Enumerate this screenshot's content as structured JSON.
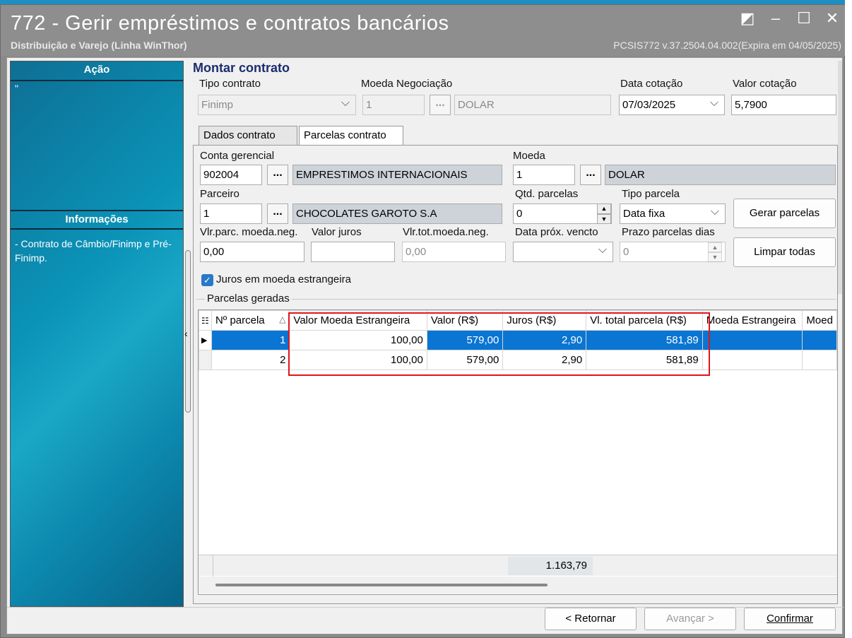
{
  "window": {
    "title": "772 - Gerir empréstimos e contratos bancários",
    "subtitle": "Distribuição e Varejo (Linha WinThor)",
    "version": "PCSIS772  v.37.2504.04.002(Expira em 04/05/2025)",
    "buttons": [
      "◩",
      "–",
      "☐",
      "✕"
    ]
  },
  "sidebar": {
    "acao_title": "Ação",
    "acao_text": "\"",
    "info_title": "Informações",
    "info_text": " - Contrato de Câmbio/Finimp e Pré-Finimp."
  },
  "form": {
    "heading": "Montar contrato",
    "tipo_contrato_label": "Tipo contrato",
    "tipo_contrato_value": "Finimp",
    "moeda_neg_label": "Moeda Negociação",
    "moeda_neg_code": "1",
    "moeda_neg_name": "DOLAR",
    "data_cotacao_label": "Data cotação",
    "data_cotacao_value": "07/03/2025",
    "valor_cotacao_label": "Valor cotação",
    "valor_cotacao_value": "5,7900",
    "ellipsis": "..."
  },
  "tabs": [
    {
      "label": "Dados contrato"
    },
    {
      "label": "Parcelas contrato"
    }
  ],
  "parcelas": {
    "conta_label": "Conta gerencial",
    "conta_code": "902004",
    "conta_name": "EMPRESTIMOS INTERNACIONAIS",
    "moeda_label": "Moeda",
    "moeda_code": "1",
    "moeda_name": "DOLAR",
    "parceiro_label": "Parceiro",
    "parceiro_code": "1",
    "parceiro_name": "CHOCOLATES GAROTO S.A",
    "qtd_label": "Qtd. parcelas",
    "qtd_value": "0",
    "tipo_parcela_label": "Tipo parcela",
    "tipo_parcela_value": "Data fixa",
    "gerar_button": "Gerar parcelas",
    "limpar_button": "Limpar todas",
    "vlr_parc_label": "Vlr.parc. moeda.neg.",
    "vlr_parc_value": "0,00",
    "valor_juros_label": "Valor juros",
    "valor_juros_value": "",
    "vlr_tot_label": "Vlr.tot.moeda.neg.",
    "vlr_tot_value": "0,00",
    "data_prox_label": "Data próx. vencto",
    "data_prox_value": "",
    "prazo_label": "Prazo parcelas dias",
    "prazo_value": "0",
    "juros_check_label": "Juros em moeda estrangeira",
    "juros_checked": true,
    "group_label": "Parcelas geradas"
  },
  "grid": {
    "columns": [
      "Nº parcela",
      "Valor Moeda Estrangeira",
      "Valor (R$)",
      "Juros (R$)",
      "Vl. total parcela (R$)",
      "Moeda Estrangeira",
      "Moed"
    ],
    "rows": [
      {
        "n": "1",
        "vme": "100,00",
        "valor": "579,00",
        "juros": "2,90",
        "total": "581,89",
        "me": "",
        "m": ""
      },
      {
        "n": "2",
        "vme": "100,00",
        "valor": "579,00",
        "juros": "2,90",
        "total": "581,89",
        "me": "",
        "m": ""
      }
    ],
    "footer_total": "1.163,79"
  },
  "footer": {
    "retornar": "< Retornar",
    "avancar": "Avançar >",
    "confirmar": "Confirmar"
  }
}
